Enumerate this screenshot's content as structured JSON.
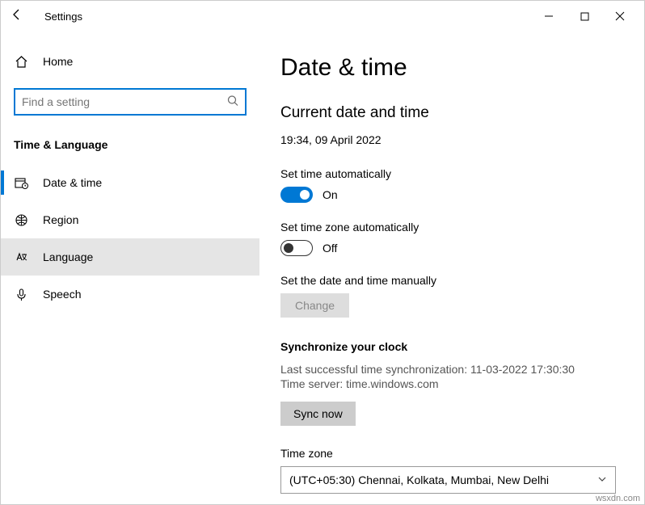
{
  "titlebar": {
    "title": "Settings"
  },
  "sidebar": {
    "home": "Home",
    "search_placeholder": "Find a setting",
    "section": "Time & Language",
    "items": [
      {
        "label": "Date & time"
      },
      {
        "label": "Region"
      },
      {
        "label": "Language"
      },
      {
        "label": "Speech"
      }
    ]
  },
  "main": {
    "title": "Date & time",
    "current_heading": "Current date and time",
    "current_value": "19:34, 09 April 2022",
    "auto_time_label": "Set time automatically",
    "auto_time_state": "On",
    "auto_tz_label": "Set time zone automatically",
    "auto_tz_state": "Off",
    "manual_label": "Set the date and time manually",
    "change_button": "Change",
    "sync_heading": "Synchronize your clock",
    "sync_last": "Last successful time synchronization: 11-03-2022 17:30:30",
    "sync_server": "Time server: time.windows.com",
    "sync_button": "Sync now",
    "tz_label": "Time zone",
    "tz_value": "(UTC+05:30) Chennai, Kolkata, Mumbai, New Delhi"
  },
  "watermark": "wsxdn.com"
}
